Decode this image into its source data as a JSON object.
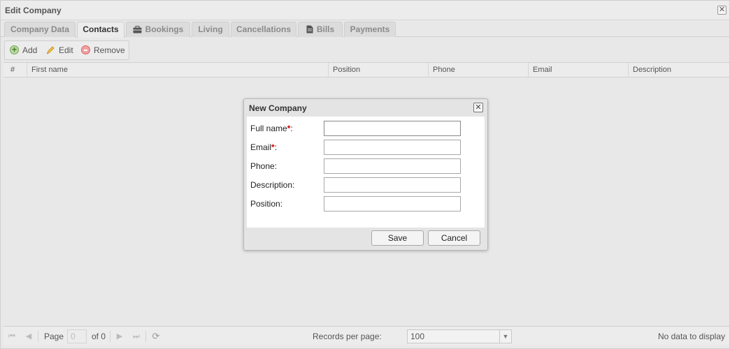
{
  "window": {
    "title": "Edit Company"
  },
  "tabs": [
    {
      "label": "Company Data",
      "icon": ""
    },
    {
      "label": "Contacts",
      "icon": ""
    },
    {
      "label": "Bookings",
      "icon": "briefcase-icon"
    },
    {
      "label": "Living",
      "icon": ""
    },
    {
      "label": "Cancellations",
      "icon": ""
    },
    {
      "label": "Bills",
      "icon": "document-icon"
    },
    {
      "label": "Payments",
      "icon": ""
    }
  ],
  "toolbar": {
    "add_label": "Add",
    "edit_label": "Edit",
    "remove_label": "Remove"
  },
  "grid": {
    "columns": [
      "#",
      "First name",
      "Position",
      "Phone",
      "Email",
      "Description"
    ],
    "rows": []
  },
  "pager": {
    "page_label": "Page",
    "page_value": "0",
    "of_label": "of 0",
    "records_label": "Records per page:",
    "records_value": "100",
    "status": "No data to display"
  },
  "dialog": {
    "title": "New Company",
    "fields": [
      {
        "label": "Full name",
        "required": true,
        "value": ""
      },
      {
        "label": "Email",
        "required": true,
        "value": ""
      },
      {
        "label": "Phone",
        "required": false,
        "value": ""
      },
      {
        "label": "Description",
        "required": false,
        "value": ""
      },
      {
        "label": "Position",
        "required": false,
        "value": ""
      }
    ],
    "save_label": "Save",
    "cancel_label": "Cancel"
  },
  "colors": {
    "required": "#cc0000",
    "active_tab_text": "#333333",
    "inactive_tab_text": "#8a8a8a"
  }
}
